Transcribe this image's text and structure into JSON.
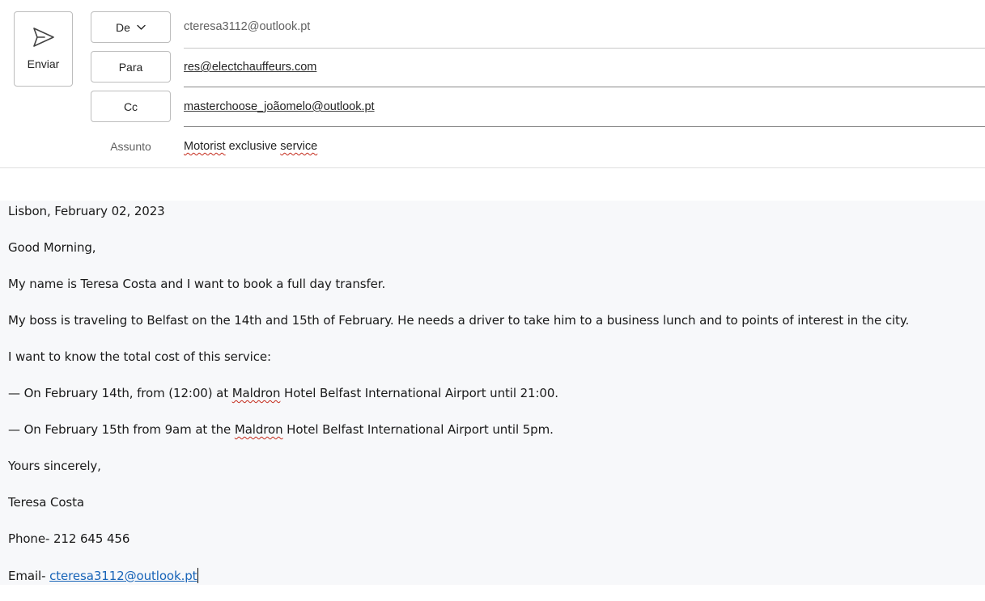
{
  "toolbar": {
    "send_label": "Enviar"
  },
  "header": {
    "from_label": "De",
    "from_value": "cteresa3112@outlook.pt",
    "to_label": "Para",
    "to_value": "res@electchauffeurs.com",
    "cc_label": "Cc",
    "cc_value": "masterchoose_joãomelo@outlook.pt",
    "subject_label": "Assunto",
    "subject_word1": "Motorist",
    "subject_word2": " exclusive ",
    "subject_word3": "service"
  },
  "body": {
    "line1": "Lisbon, February 02, 2023",
    "line2": "Good Morning,",
    "line3": "My name is Teresa Costa and I want to book a full day transfer.",
    "line4": "My boss is traveling to Belfast on the 14th and 15th of February. He needs a driver to take him to a business lunch and to points of interest in the city.",
    "line5": "I want to know the total cost of this service:",
    "line6_pre": "— On February 14th, from (12:00) at ",
    "line6_word": "Maldron",
    "line6_post": " Hotel Belfast International Airport until 21:00.",
    "line7_pre": "— On February 15th from 9am at the ",
    "line7_word": "Maldron",
    "line7_post": " Hotel Belfast International Airport until 5pm.",
    "line8": "Yours sincerely,",
    "line9": "Teresa Costa",
    "line10": "Phone- 212 645 456",
    "line11_label": "Email- ",
    "line11_email": "cteresa3112@outlook.pt"
  },
  "colors": {
    "link": "#1864b8",
    "spellcheck": "#c42b1c",
    "body_background": "#f7f8fa"
  },
  "icons": {
    "send": "send-icon",
    "from_dropdown": "chevron-down-icon"
  }
}
